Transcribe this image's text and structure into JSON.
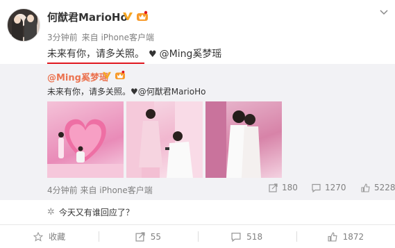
{
  "post": {
    "username": "何猷君MarioHo",
    "time": "3分钟前",
    "source": "来自 iPhone客户端",
    "text_main": "未来有你，请多关照。",
    "heart": "♥",
    "mention": "@Ming奚梦瑶"
  },
  "repost": {
    "username": "@Ming奚梦瑶",
    "text": "未来有你，请多关照。♥@何猷君MarioHo",
    "time": "4分钟前",
    "source": "来自 iPhone客户端",
    "reposts": "180",
    "comments": "1270",
    "likes": "5228"
  },
  "comment_hint": "今天又有谁回应了？",
  "actions": {
    "favorite": "收藏",
    "repost": "55",
    "comment": "518",
    "like": "1872"
  },
  "colors": {
    "accent_orange": "#eb7350",
    "underline_red": "#e0161e",
    "verified_orange": "#f6a623",
    "repost_bg": "#f2f2f5"
  }
}
